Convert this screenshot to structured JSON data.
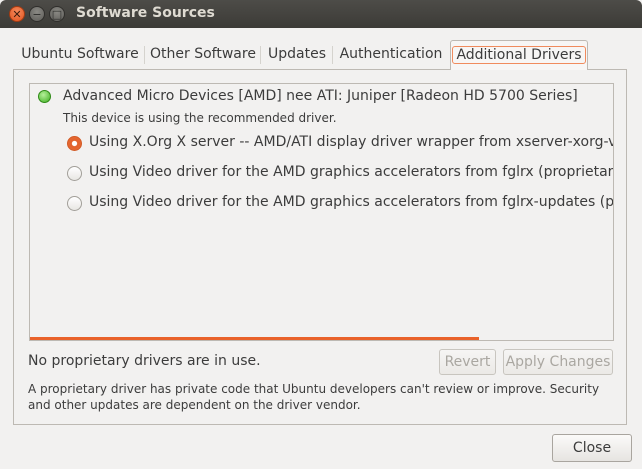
{
  "window": {
    "title": "Software Sources",
    "close_glyph": "✕",
    "minimize_glyph": "−",
    "maximize_glyph": "□"
  },
  "tabs": [
    {
      "label": "Ubuntu Software",
      "active": false
    },
    {
      "label": "Other Software",
      "active": false
    },
    {
      "label": "Updates",
      "active": false
    },
    {
      "label": "Authentication",
      "active": false
    },
    {
      "label": "Additional Drivers",
      "active": true
    }
  ],
  "device": {
    "name": "Advanced Micro Devices [AMD] nee ATI: Juniper [Radeon HD 5700 Series]",
    "status_text": "This device is using the recommended driver.",
    "status_color": "#3fae20",
    "options": [
      {
        "label": "Using X.Org X server -- AMD/ATI display driver wrapper from xserver-xorg-video-ati (open source, tested)",
        "checked": true
      },
      {
        "label": "Using Video driver for the AMD graphics accelerators from fglrx (proprietary)",
        "checked": false
      },
      {
        "label": "Using Video driver for the AMD graphics accelerators from fglrx-updates (proprietary)",
        "checked": false
      }
    ]
  },
  "progress_fraction": 0.77,
  "footer": {
    "status": "No proprietary drivers are in use.",
    "revert_label": "Revert",
    "apply_label": "Apply Changes",
    "note": "A proprietary driver has private code that Ubuntu developers can't review or improve. Security and other updates are dependent on the driver vendor.",
    "close_label": "Close"
  },
  "colors": {
    "accent": "#e9622a",
    "titlebar": "#3c3b37"
  }
}
